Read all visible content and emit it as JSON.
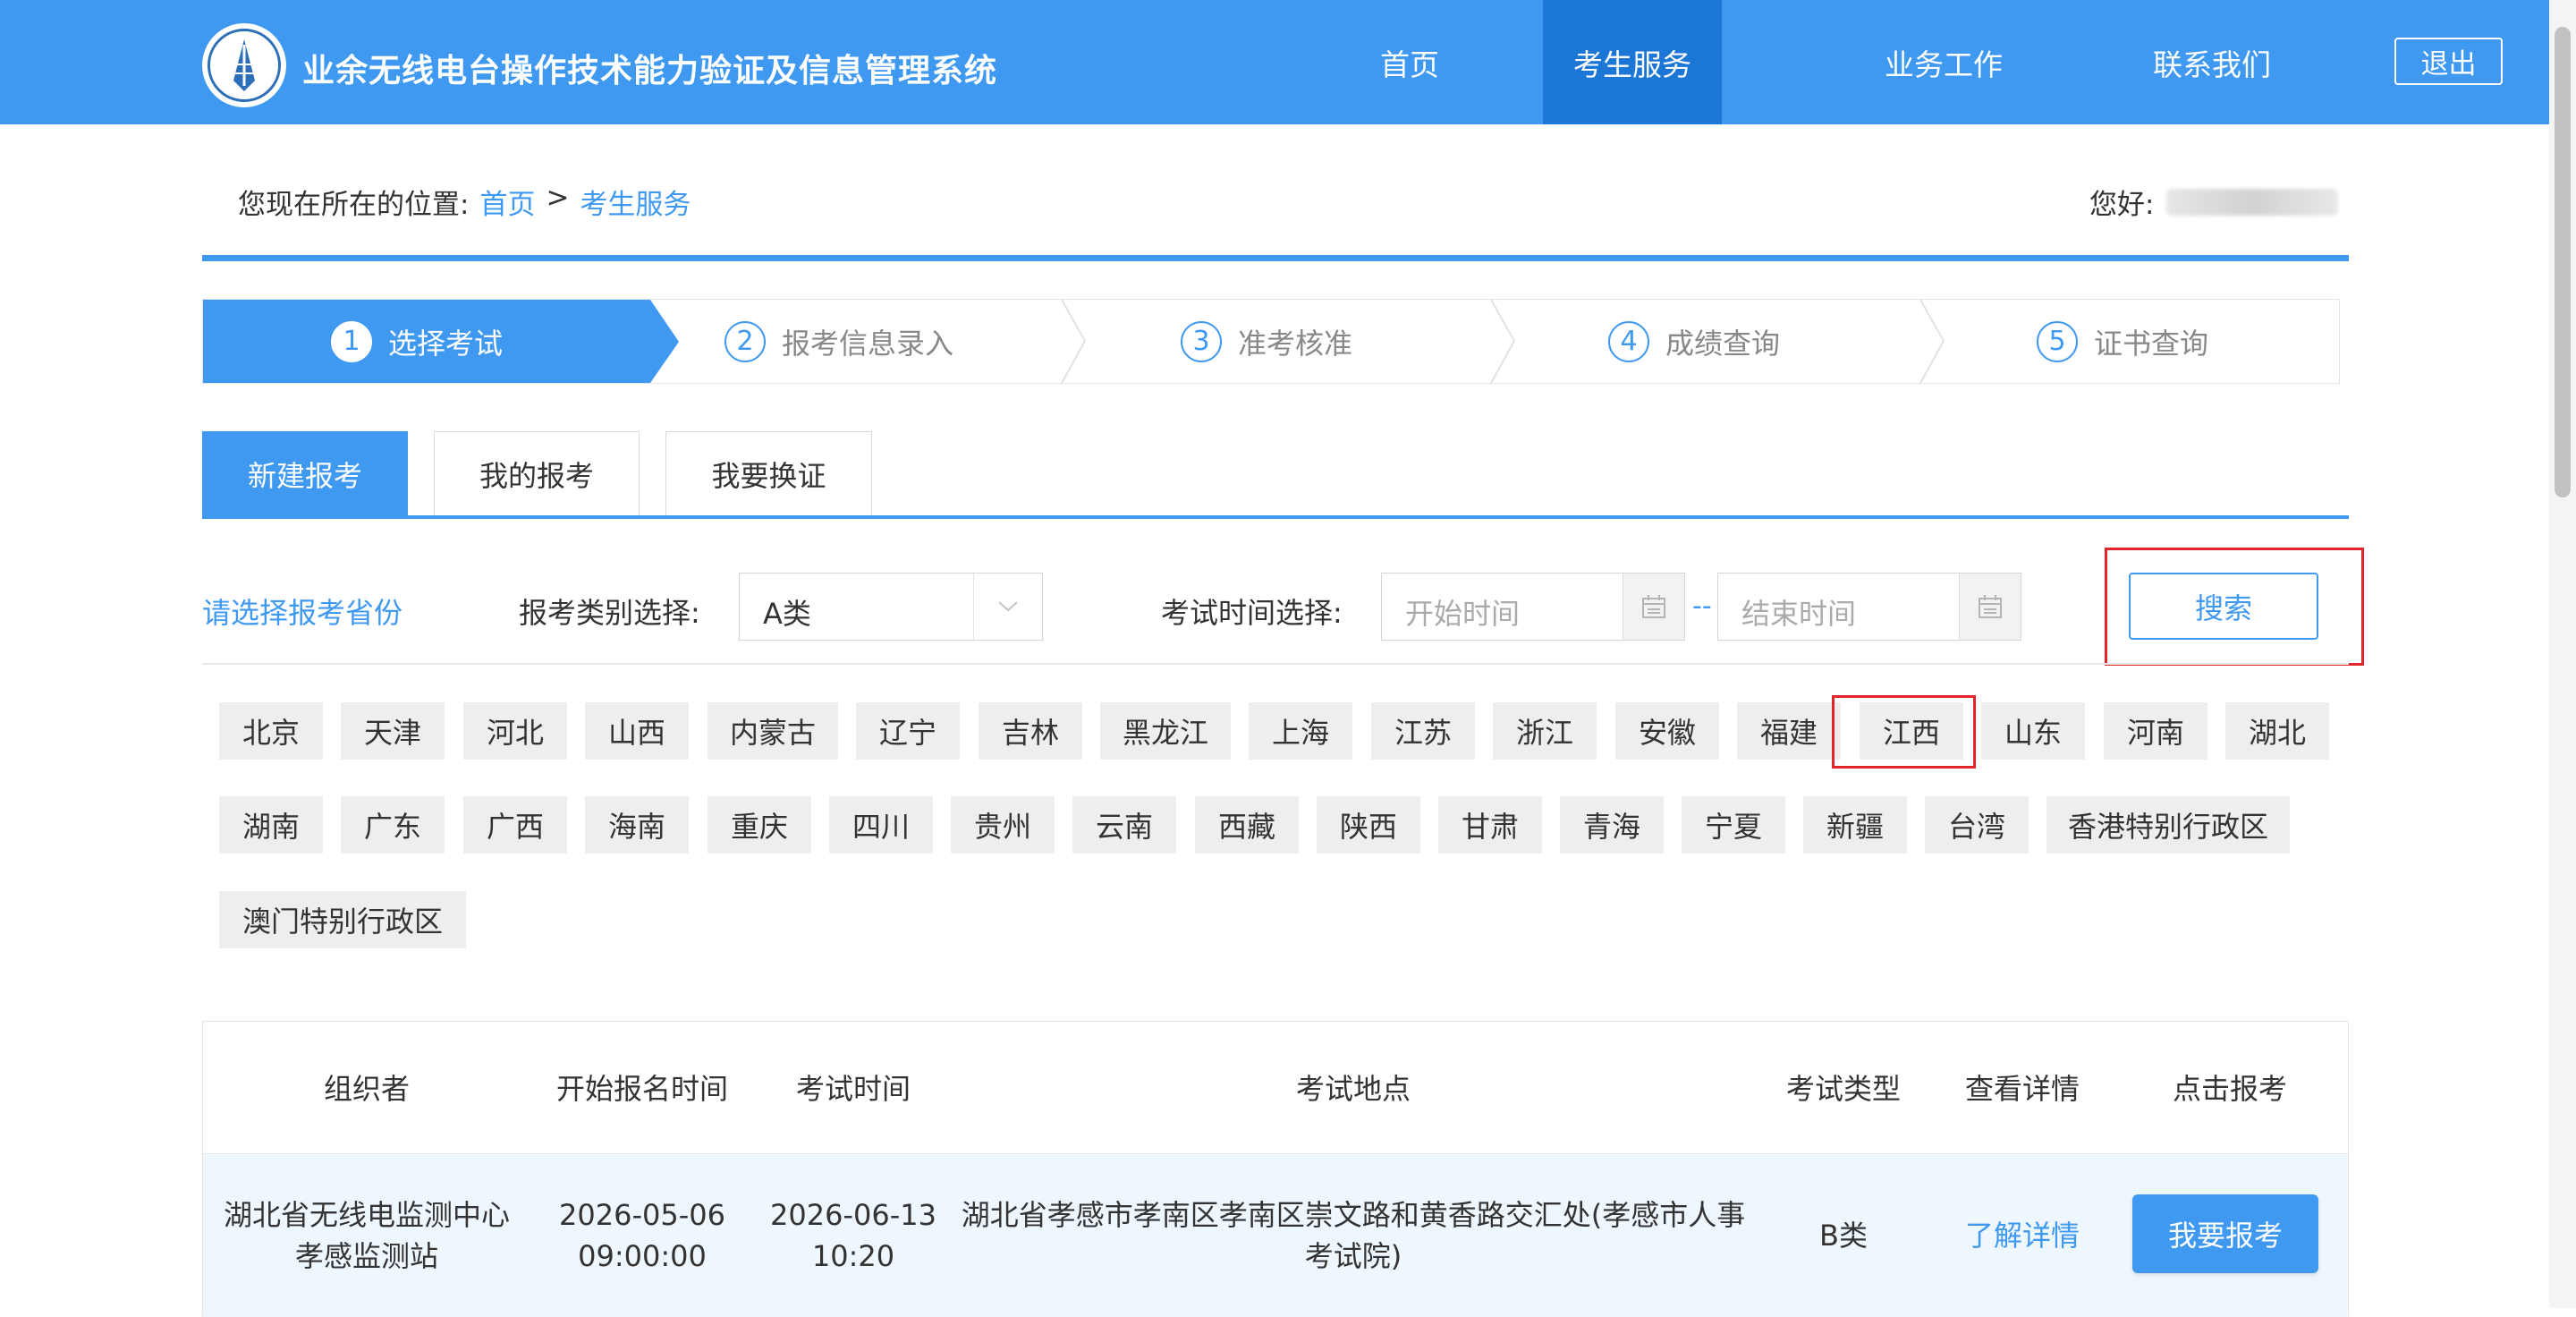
{
  "header": {
    "site_title": "业余无线电台操作技术能力验证及信息管理系统",
    "nav": [
      "首页",
      "考生服务",
      "业务工作",
      "联系我们"
    ],
    "active_nav": "考生服务",
    "logout_label": "退出"
  },
  "breadcrumb": {
    "prefix": "您现在所在的位置:",
    "items": [
      "首页",
      "考生服务"
    ],
    "separator": ">"
  },
  "greeting": "您好:",
  "steps": [
    {
      "num": "1",
      "label": "选择考试"
    },
    {
      "num": "2",
      "label": "报考信息录入"
    },
    {
      "num": "3",
      "label": "准考核准"
    },
    {
      "num": "4",
      "label": "成绩查询"
    },
    {
      "num": "5",
      "label": "证书查询"
    }
  ],
  "tabs": [
    "新建报考",
    "我的报考",
    "我要换证"
  ],
  "filters": {
    "province_prompt": "请选择报考省份",
    "category_label": "报考类别选择:",
    "category_value": "A类",
    "time_label": "考试时间选择:",
    "start_placeholder": "开始时间",
    "end_placeholder": "结束时间",
    "range_separator": "--",
    "search_label": "搜索"
  },
  "provinces": [
    "北京",
    "天津",
    "河北",
    "山西",
    "内蒙古",
    "辽宁",
    "吉林",
    "黑龙江",
    "上海",
    "江苏",
    "浙江",
    "安徽",
    "福建",
    "江西",
    "山东",
    "河南",
    "湖北",
    "湖南",
    "广东",
    "广西",
    "海南",
    "重庆",
    "四川",
    "贵州",
    "云南",
    "西藏",
    "陕西",
    "甘肃",
    "青海",
    "宁夏",
    "新疆",
    "台湾",
    "香港特别行政区",
    "澳门特别行政区"
  ],
  "table": {
    "headers": [
      "组织者",
      "开始报名时间",
      "考试时间",
      "考试地点",
      "考试类型",
      "查看详情",
      "点击报考"
    ],
    "rows": [
      {
        "organizer": "湖北省无线电监测中心孝感监测站",
        "signup_date": "2026-05-06",
        "signup_time": "09:00:00",
        "exam_date": "2026-06-13",
        "exam_time": "10:20",
        "location": "湖北省孝感市孝南区孝南区崇文路和黄香路交汇处(孝感市人事考试院)",
        "exam_type": "B类",
        "detail_label": "了解详情",
        "apply_label": "我要报考"
      }
    ]
  },
  "colors": {
    "primary": "#3f99f1",
    "active_nav": "#1b76d6",
    "highlight": "#e0262b"
  }
}
